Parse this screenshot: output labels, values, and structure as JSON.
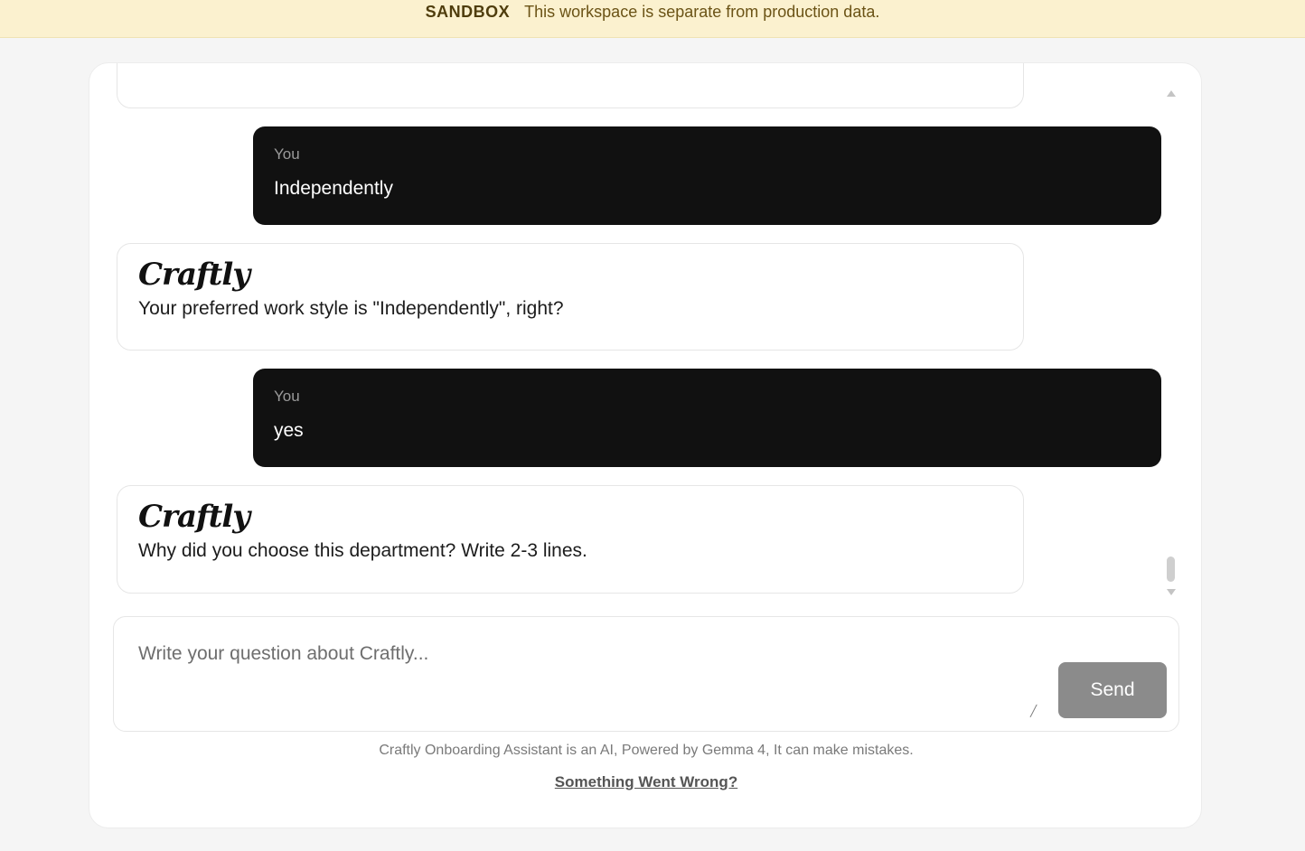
{
  "banner": {
    "tag": "SANDBOX",
    "message": "This workspace is separate from production data."
  },
  "messages": [
    {
      "role": "bot",
      "partial": true,
      "logo": "",
      "text": ""
    },
    {
      "role": "user",
      "label": "You",
      "text": "Independently"
    },
    {
      "role": "bot",
      "logo": "Craftly",
      "text": "Your preferred work style is \"Independently\", right?"
    },
    {
      "role": "user",
      "label": "You",
      "text": "yes"
    },
    {
      "role": "bot",
      "logo": "Craftly",
      "text": "Why did you choose this department? Write 2-3 lines."
    }
  ],
  "composer": {
    "placeholder": "Write your question about Craftly...",
    "value": "",
    "send_label": "Send"
  },
  "footer": {
    "disclaimer": "Craftly Onboarding Assistant is an AI, Powered by Gemma 4, It can make mistakes.",
    "report_link": "Something Went Wrong?"
  }
}
